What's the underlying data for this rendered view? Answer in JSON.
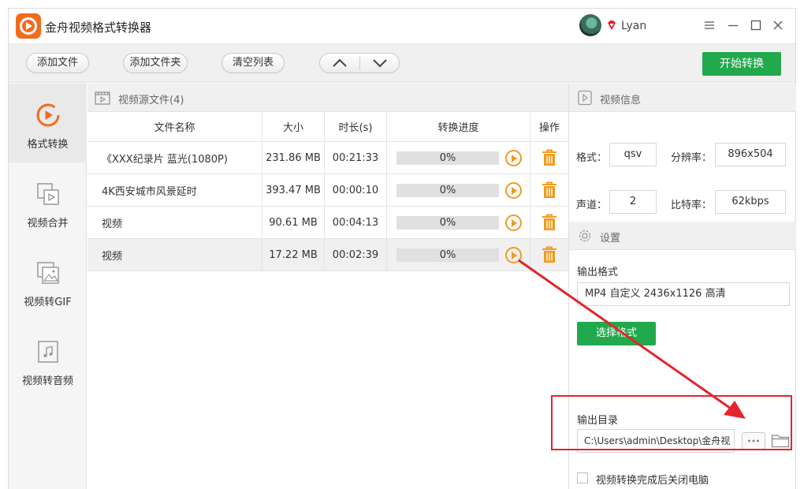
{
  "app": {
    "title": "金舟视频格式转换器",
    "username": "Lyan",
    "accent_color": "#22a94d",
    "brand_color": "#f26b1d"
  },
  "window_controls": [
    "menu-icon",
    "minimize-icon",
    "maximize-icon",
    "close-icon"
  ],
  "toolbar": {
    "add_file": "添加文件",
    "add_folder": "添加文件夹",
    "clear_list": "清空列表",
    "start_convert": "开始转换"
  },
  "sidebar": {
    "items": [
      {
        "label": "格式转换",
        "icon": "format-convert-icon",
        "active": true
      },
      {
        "label": "视频合并",
        "icon": "video-merge-icon",
        "active": false
      },
      {
        "label": "视频转GIF",
        "icon": "image-icon",
        "active": false
      },
      {
        "label": "视频转音频",
        "icon": "music-file-icon",
        "active": false
      }
    ]
  },
  "file_list": {
    "title": "视频源文件(4)",
    "columns": [
      "文件名称",
      "大小",
      "时长(s)",
      "转换进度",
      "操作"
    ],
    "rows": [
      {
        "name": "《XXX纪录片 蓝光(1080P)",
        "size": "231.86 MB",
        "duration": "00:21:33",
        "progress": "0%"
      },
      {
        "name": "4K西安城市风景延时",
        "size": "393.47 MB",
        "duration": "00:00:10",
        "progress": "0%"
      },
      {
        "name": "视频",
        "size": "90.61 MB",
        "duration": "00:04:13",
        "progress": "0%"
      },
      {
        "name": "视频",
        "size": "17.22 MB",
        "duration": "00:02:39",
        "progress": "0%"
      }
    ],
    "selected_row": 3
  },
  "video_info": {
    "title": "视频信息",
    "format_label": "格式：",
    "format_value": "qsv",
    "resolution_label": "分辨率：",
    "resolution_value": "896x504",
    "channel_label": "声道：",
    "channel_value": "2",
    "bitrate_label": "比特率：",
    "bitrate_value": "62kbps"
  },
  "settings": {
    "title": "设置",
    "output_format_label": "输出格式",
    "output_format_value": "MP4 自定义 2436x1126 高清",
    "select_format_button": "选择格式",
    "output_dir_label": "输出目录",
    "output_dir_value": "C:\\Users\\admin\\Desktop\\金舟视",
    "shutdown_label": "视频转换完成后关闭电脑"
  },
  "annotation": {
    "color": "#e5242b"
  }
}
